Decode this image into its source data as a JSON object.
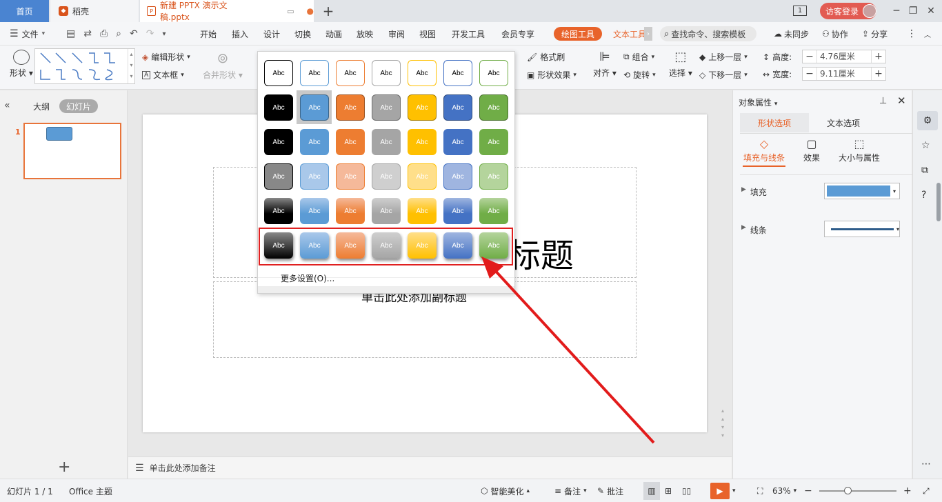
{
  "tabs": {
    "home": "首页",
    "daoke": "稻壳",
    "doc": "新建 PPTX 演示文稿.pptx"
  },
  "window": {
    "page_num": "1",
    "login": "访客登录"
  },
  "menu": {
    "file": "文件",
    "items": [
      "开始",
      "插入",
      "设计",
      "切换",
      "动画",
      "放映",
      "审阅",
      "视图",
      "开发工具",
      "会员专享"
    ],
    "drawing_tools": "绘图工具",
    "text_tools": "文本工具",
    "search": "查找命令、搜索模板",
    "sync": "未同步",
    "collab": "协作",
    "share": "分享"
  },
  "ribbon": {
    "shape": "形状",
    "edit_shape": "编辑形状",
    "textbox": "文本框",
    "merge_shape": "合并形状",
    "format_painter": "格式刷",
    "shape_effect": "形状效果",
    "align": "对齐",
    "group": "组合",
    "rotate": "旋转",
    "select": "选择",
    "bring_forward": "上移一层",
    "send_backward": "下移一层",
    "height_label": "高度:",
    "height_value": "4.76厘米",
    "width_label": "宽度:",
    "width_value": "9.11厘米"
  },
  "left_panel": {
    "outline": "大纲",
    "slides": "幻灯片",
    "slide_number": "1"
  },
  "slide": {
    "title_fragment": "标题",
    "subtitle_text": "单击此处添加副标题"
  },
  "notes": {
    "placeholder": "单击此处添加备注"
  },
  "style_gallery": {
    "swatch_label": "Abc",
    "more_settings": "更多设置(O)...",
    "row_colors": [
      "#000000",
      "#5b9bd5",
      "#ed7d31",
      "#a5a5a5",
      "#ffc000",
      "#4472c4",
      "#70ad47"
    ]
  },
  "right_panel": {
    "title": "对象属性",
    "tab_shape": "形状选项",
    "tab_text": "文本选项",
    "sub_fill_line": "填充与线条",
    "sub_effect": "效果",
    "sub_size": "大小与属性",
    "fill": "填充",
    "line": "线条",
    "fill_color": "#5b9bd5",
    "line_color": "#2e5c8a"
  },
  "status": {
    "slide_count": "幻灯片 1 / 1",
    "theme": "Office 主题",
    "beautify": "智能美化",
    "notes": "备注",
    "comments": "批注",
    "zoom": "63%"
  }
}
